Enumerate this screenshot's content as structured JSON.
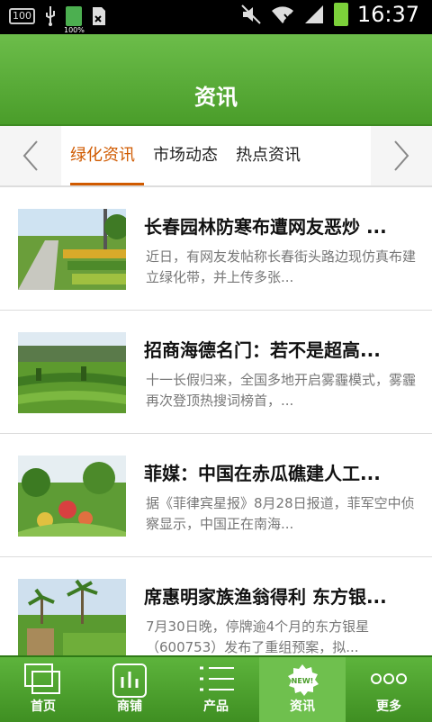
{
  "status_bar": {
    "time": "16:37",
    "left_box": "100",
    "battery_small_label": "100%",
    "icons": [
      "usb-icon",
      "battery-charged-icon",
      "sd-card-icon",
      "mute-icon",
      "wifi-icon",
      "signal-icon",
      "battery-icon"
    ]
  },
  "header": {
    "title": "资讯"
  },
  "tabs": {
    "items": [
      {
        "label": "绿化资讯",
        "active": true
      },
      {
        "label": "市场动态",
        "active": false
      },
      {
        "label": "热点资讯",
        "active": false
      }
    ]
  },
  "news": [
    {
      "title": "长春园林防寒布遭网友恶炒 ...",
      "desc": "近日，有网友发帖称长春街头路边现仿真布建立绿化带，并上传多张..."
    },
    {
      "title": "招商海德名门：若不是超高...",
      "desc": "十一长假归来，全国多地开启雾霾模式，雾霾再次登顶热搜词榜首，..."
    },
    {
      "title": "菲媒：中国在赤瓜礁建人工...",
      "desc": "据《菲律宾星报》8月28日报道，菲军空中侦察显示，中国正在南海..."
    },
    {
      "title": "席惠明家族渔翁得利 东方银...",
      "desc": "7月30日晚，停牌逾4个月的东方银星（600753）发布了重组预案，拟..."
    }
  ],
  "bottom_nav": {
    "items": [
      {
        "label": "首页",
        "icon": "home-icon"
      },
      {
        "label": "商铺",
        "icon": "shop-icon"
      },
      {
        "label": "产品",
        "icon": "product-list-icon"
      },
      {
        "label": "资讯",
        "icon": "news-badge-icon",
        "badge": "NEW!",
        "active": true
      },
      {
        "label": "更多",
        "icon": "more-icon"
      }
    ]
  },
  "colors": {
    "brand_green": "#4a9d2a",
    "active_tab": "#d05a00"
  }
}
